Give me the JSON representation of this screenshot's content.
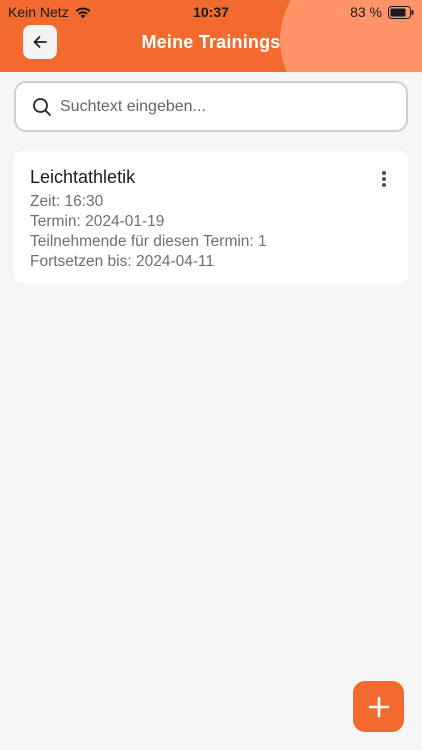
{
  "status_bar": {
    "carrier": "Kein Netz",
    "time": "10:37",
    "battery": "83 %",
    "wifi_icon": "wifi-icon",
    "battery_icon": "battery-icon"
  },
  "header": {
    "title": "Meine Trainings",
    "back_icon": "arrow-left-icon",
    "background_color": "#f26a2e",
    "accent_color": "#ff9469"
  },
  "search": {
    "placeholder": "Suchtext eingeben...",
    "value": "",
    "icon": "search-icon"
  },
  "trainings": [
    {
      "title": "Leichtathletik",
      "time": "Zeit: 16:30",
      "date": "Termin: 2024-01-19",
      "participants": "Teilnehmende für diesen Termin: 1",
      "continue_until": "Fortsetzen bis: 2024-04-11",
      "menu_icon": "more-vertical-icon"
    }
  ],
  "fab": {
    "icon": "plus-icon",
    "color": "#f26a2e"
  }
}
